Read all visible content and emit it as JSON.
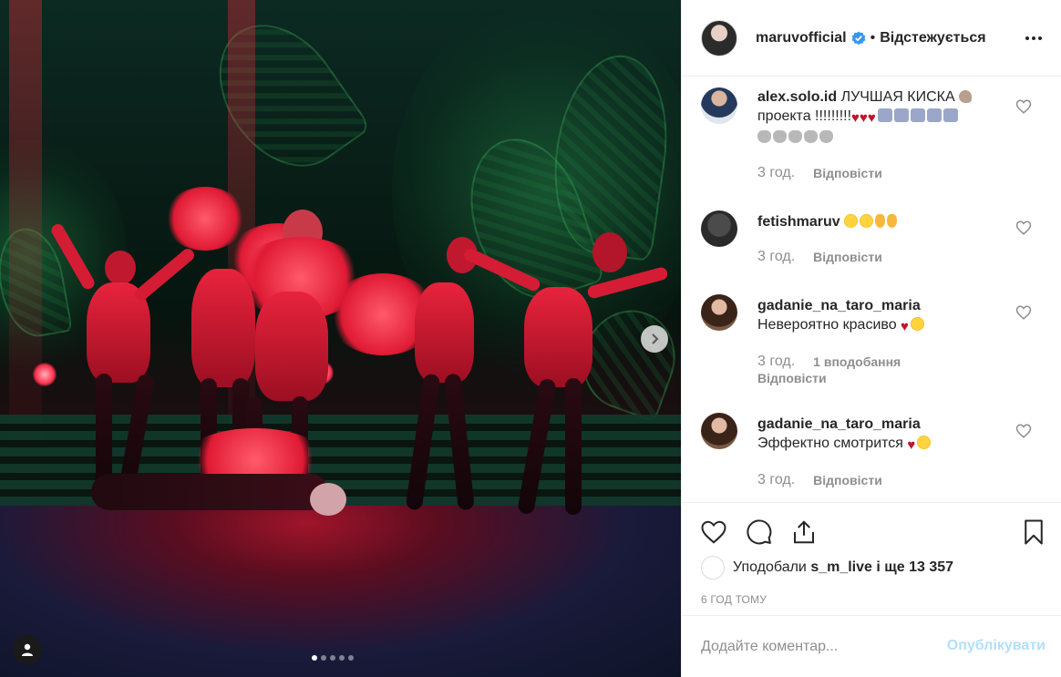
{
  "post_header": {
    "username": "maruvofficial",
    "separator": "•",
    "follow_status": "Відстежується"
  },
  "comments": [
    {
      "username": "alex.solo.id",
      "text": "ЛУЧШАЯ КИСКА",
      "text2": "проекта !!!!!!!!!",
      "time": "3 год.",
      "reply": "Відповісти"
    },
    {
      "username": "fetishmaruv",
      "text": "",
      "time": "3 год.",
      "reply": "Відповісти"
    },
    {
      "username": "gadanie_na_taro_maria",
      "text": "Невероятно красиво",
      "time": "3 год.",
      "likes": "1 вподобання",
      "reply": "Відповісти"
    },
    {
      "username": "gadanie_na_taro_maria",
      "text": "Эффектно смотрится",
      "time": "3 год.",
      "reply": "Відповісти"
    }
  ],
  "likes": {
    "prefix": "Уподобали",
    "user": "s_m_live",
    "suffix": "і ще 13 357"
  },
  "post_time": "6 ГОД ТОМУ",
  "comment_box": {
    "placeholder": "Додайте коментар...",
    "publish_label": "Опублікувати"
  },
  "carousel": {
    "total": 5,
    "active_index": 0
  },
  "colors": {
    "text": "#262626",
    "muted": "#8e8e8e",
    "verified": "#3897f0",
    "publish_disabled": "#b2dffc",
    "heart_red": "#c0152a"
  }
}
